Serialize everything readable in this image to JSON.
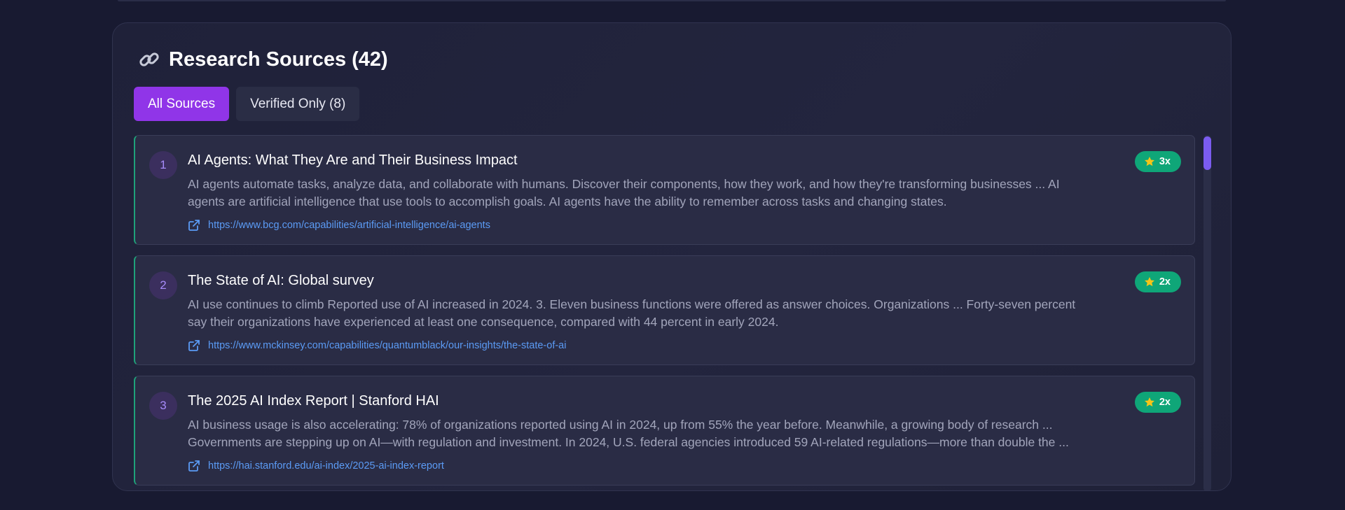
{
  "panel": {
    "title": "Research Sources (42)",
    "title_icon": "link-icon"
  },
  "tabs": [
    {
      "label": "All Sources",
      "active": true
    },
    {
      "label": "Verified Only (8)",
      "active": false
    }
  ],
  "sources": [
    {
      "number": "1",
      "title": "AI Agents: What They Are and Their Business Impact",
      "snippet_line1": "AI agents automate tasks, analyze data, and collaborate with humans. Discover their components, how they work, and how they're transforming businesses ... AI",
      "snippet_line2": "agents are artificial intelligence that use tools to accomplish goals. AI agents have the ability to remember across tasks and changing states.",
      "url": "https://www.bcg.com/capabilities/artificial-intelligence/ai-agents",
      "badge": "3x"
    },
    {
      "number": "2",
      "title": "The State of AI: Global survey",
      "snippet_line1": "AI use continues to climb Reported use of AI increased in 2024. 3. Eleven business functions were offered as answer choices. Organizations ... Forty-seven percent",
      "snippet_line2": "say their organizations have experienced at least one consequence, compared with 44 percent in early 2024.",
      "url": "https://www.mckinsey.com/capabilities/quantumblack/our-insights/the-state-of-ai",
      "badge": "2x"
    },
    {
      "number": "3",
      "title": "The 2025 AI Index Report | Stanford HAI",
      "snippet_line1": "AI business usage is also accelerating: 78% of organizations reported using AI in 2024, up from 55% the year before. Meanwhile, a growing body of research ...",
      "snippet_line2": "Governments are stepping up on AI—with regulation and investment. In 2024, U.S. federal agencies introduced 59 AI-related regulations—more than double the ...",
      "url": "https://hai.stanford.edu/ai-index/2025-ai-index-report",
      "badge": "2x"
    }
  ],
  "colors": {
    "background": "#181a31",
    "accent": "#9035e8",
    "badge": "#0fa678",
    "link": "#5b9bf5",
    "card_border_accent": "#1ea27a"
  },
  "scrollbar": {
    "position_fraction": 0.0
  }
}
